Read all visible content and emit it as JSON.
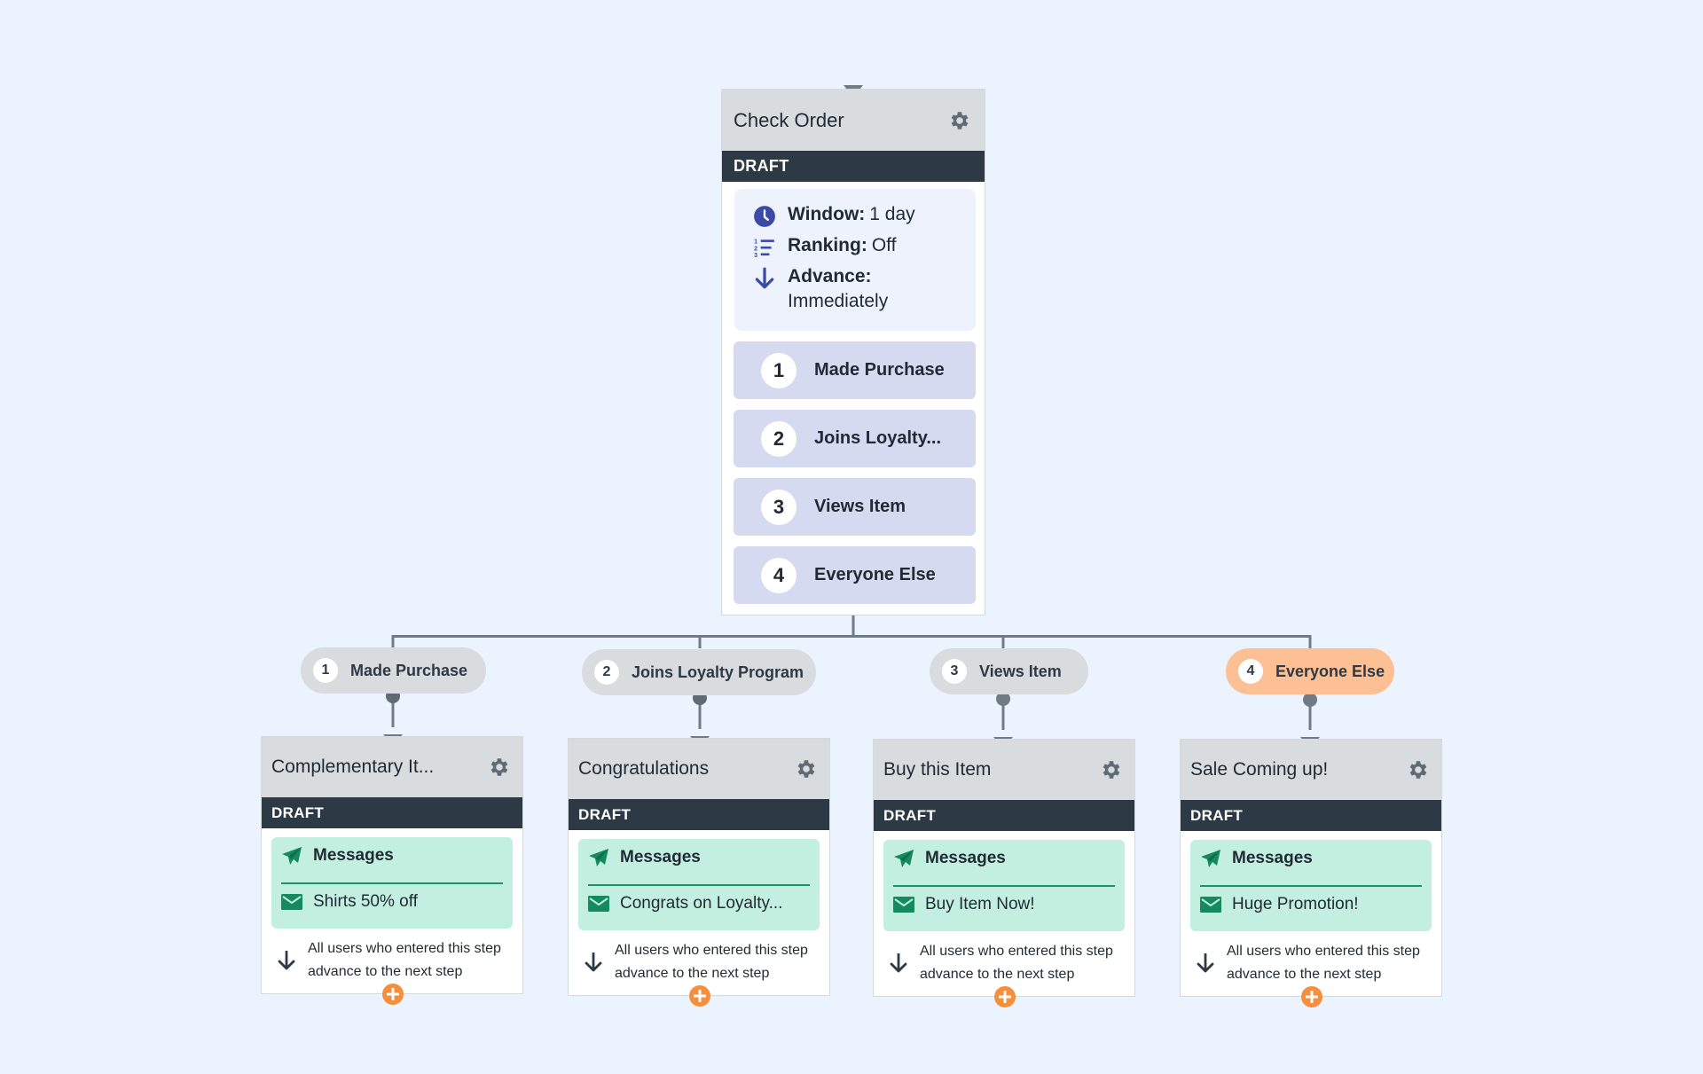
{
  "colors": {
    "background": "#ebf3fe",
    "header_gray": "#d8dcdf",
    "draft_dark": "#2d3a45",
    "branch_item_bg": "#d5daf0",
    "info_panel_bg": "#eef2fd",
    "info_icon_blue": "#3c4aa6",
    "message_green_bg": "#c3efe0",
    "message_green_icon": "#158a5e",
    "highlight_orange": "#fdc095",
    "add_button_orange": "#f58f3d",
    "connector_gray": "#6f7c85"
  },
  "main_node": {
    "title": "Check Order",
    "status": "DRAFT",
    "settings_icon": "gear-icon",
    "info": {
      "window_label": "Window:",
      "window_value": "1 day",
      "ranking_label": "Ranking:",
      "ranking_value": "Off",
      "advance_label": "Advance:",
      "advance_value": "Immediately"
    },
    "branches": [
      {
        "number": "1",
        "label": "Made Purchase"
      },
      {
        "number": "2",
        "label": "Joins Loyalty..."
      },
      {
        "number": "3",
        "label": "Views Item"
      },
      {
        "number": "4",
        "label": "Everyone Else"
      }
    ]
  },
  "branch_pills": [
    {
      "number": "1",
      "label": "Made Purchase",
      "highlighted": false
    },
    {
      "number": "2",
      "label": "Joins Loyalty Program",
      "highlighted": false
    },
    {
      "number": "3",
      "label": "Views Item",
      "highlighted": false
    },
    {
      "number": "4",
      "label": "Everyone Else",
      "highlighted": true
    }
  ],
  "child_steps": [
    {
      "title": "Complementary It...",
      "status": "DRAFT",
      "messages_label": "Messages",
      "message": "Shirts 50% off",
      "advance_text": "All users who entered this step advance to the next step"
    },
    {
      "title": "Congratulations",
      "status": "DRAFT",
      "messages_label": "Messages",
      "message": "Congrats on Loyalty...",
      "advance_text": "All users who entered this step advance to the next step"
    },
    {
      "title": "Buy this Item",
      "status": "DRAFT",
      "messages_label": "Messages",
      "message": "Buy Item Now!",
      "advance_text": "All users who entered this step advance to the next step"
    },
    {
      "title": "Sale Coming up!",
      "status": "DRAFT",
      "messages_label": "Messages",
      "message": "Huge Promotion!",
      "advance_text": "All users who entered this step advance to the next step"
    }
  ]
}
